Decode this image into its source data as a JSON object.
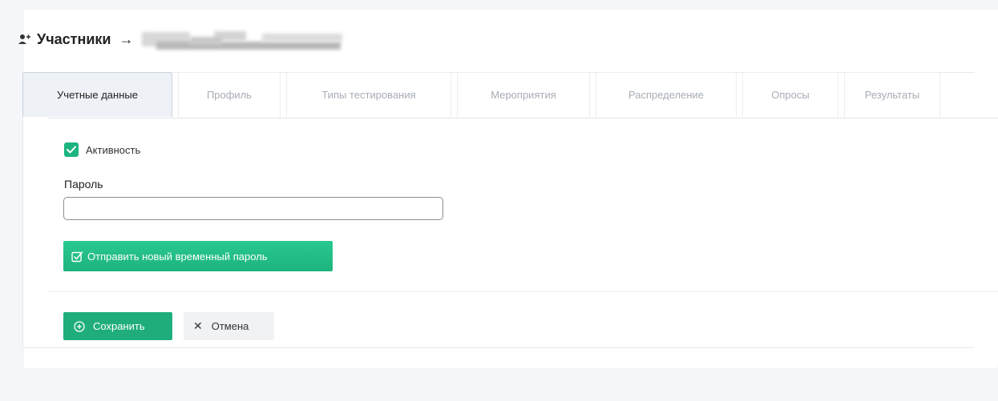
{
  "header": {
    "title": "Участники",
    "arrow": "→",
    "user_icon": "user-icon"
  },
  "tabs": [
    {
      "label": "Учетные данные",
      "active": true
    },
    {
      "label": "Профиль",
      "active": false
    },
    {
      "label": "Типы тестирования",
      "active": false
    },
    {
      "label": "Мероприятия",
      "active": false
    },
    {
      "label": "Распределение",
      "active": false
    },
    {
      "label": "Опросы",
      "active": false
    },
    {
      "label": "Результаты",
      "active": false
    }
  ],
  "form": {
    "active_checkbox": {
      "label": "Активность",
      "checked": true
    },
    "password": {
      "label": "Пароль",
      "value": "",
      "placeholder": ""
    },
    "send_button": {
      "label": "Отправить новый временный пароль",
      "icon": "edit-square-icon"
    }
  },
  "actions": {
    "save_label": "Сохранить",
    "save_icon": "plus-circle-icon",
    "cancel_label": "Отмена",
    "cancel_icon": "close-icon"
  },
  "colors": {
    "accent": "#1fae7b",
    "send_button": "#24c089",
    "page_background": "#f4f6f9"
  }
}
